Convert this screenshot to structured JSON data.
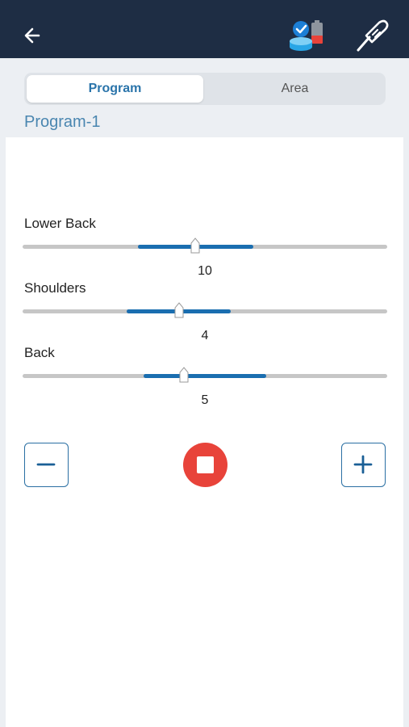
{
  "header": {
    "back_icon": "back-arrow-icon",
    "device_icon": "device-connected-battery-icon",
    "probe_icon": "electrode-probe-icon",
    "background_color": "#1e2d44"
  },
  "tabs": {
    "program_label": "Program",
    "area_label": "Area",
    "selected": "Program"
  },
  "program_title": "Program-1",
  "sliders": [
    {
      "label": "Lower Back",
      "value": "10"
    },
    {
      "label": "Shoulders",
      "value": "4"
    },
    {
      "label": "Back",
      "value": "5"
    }
  ],
  "controls": {
    "minus_icon": "minus-icon",
    "stop_icon": "stop-icon",
    "plus_icon": "plus-icon",
    "accent_color": "#1a6eb0",
    "stop_color": "#e8433a"
  }
}
